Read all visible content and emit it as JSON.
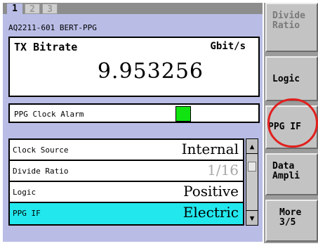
{
  "tabs": [
    "1",
    "2",
    "3"
  ],
  "module_name": "AQ2211-601 BERT-PPG",
  "bitrate": {
    "label": "TX Bitrate",
    "unit": "Gbit/s",
    "value": "9.953256"
  },
  "alarm": {
    "label": "PPG Clock Alarm",
    "status_color": "#11e311"
  },
  "settings": [
    {
      "label": "Clock Source",
      "value": "Internal"
    },
    {
      "label": "Divide Ratio",
      "value": "1/16"
    },
    {
      "label": "Logic",
      "value": "Positive"
    },
    {
      "label": "PPG IF",
      "value": "Electric"
    }
  ],
  "scroll_arrows": {
    "up": "▲",
    "down": "▼"
  },
  "softkeys": {
    "divide_ratio": [
      "Divide",
      "Ratio"
    ],
    "logic": [
      "Logic"
    ],
    "ppg_if": [
      "PPG IF"
    ],
    "data_ampli": [
      "Data",
      "Ampli"
    ],
    "more": [
      "More",
      "3/5"
    ]
  },
  "colors": {
    "panel": "#b9bde6",
    "selected_row": "#22e8ee",
    "highlight_circle": "#e1201e"
  }
}
